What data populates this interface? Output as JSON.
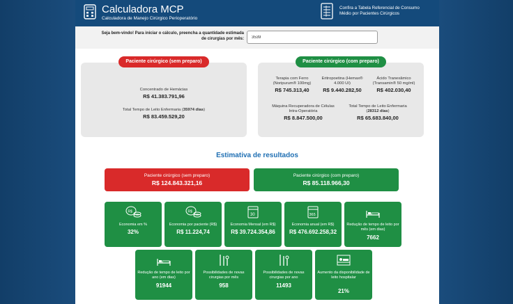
{
  "header": {
    "app_title": "Calculadora MCP",
    "app_subtitle": "Calculadora de Manejo Cirúrgico Perioperatório",
    "table_link": "Confira a Tabela Referencial de Consumo Médio por Pacientes Cirúrgicos"
  },
  "welcome": {
    "prompt": "Seja bem-vindo! Para iniciar o cálculo, preencha a quantidade estimada de cirurgias por mês:",
    "quantity_value": "3539"
  },
  "without_prep": {
    "title": "Paciente cirúrgico (sem preparo)",
    "items": [
      {
        "label": "Concentrado de Hemácias",
        "value": "R$ 41.383.791,96"
      },
      {
        "label_prefix": "Total Tempo de Leito Enfermaria (",
        "label_days": "35974 dias",
        "label_suffix": ")",
        "value": "R$ 83.459.529,20"
      }
    ]
  },
  "with_prep": {
    "title": "Paciente cirúrgico (com preparo)",
    "items": [
      {
        "label": "Terapia com Ferro (Noripurum® 100mg)",
        "value": "R$ 745.313,40"
      },
      {
        "label": "Eritropoetina (Hemax® 4.000 UI)",
        "value": "R$ 9.440.282,50"
      },
      {
        "label": "Ácido Tranexâmico (Transamin® 50 mg/ml)",
        "value": "R$ 402.030,40"
      },
      {
        "label": "Máquina Recuperadora de Células Intra-Operatória",
        "value": "R$ 8.847.500,00"
      },
      {
        "label_prefix": "Total Tempo de Leito Enfermaria (",
        "label_days": "28312 dias",
        "label_suffix": ")",
        "value": "R$ 65.683.840,00"
      }
    ]
  },
  "results": {
    "title": "Estimativa de resultados",
    "total_without": {
      "label": "Paciente cirúrgico (sem preparo)",
      "value": "R$ 124.843.321,16"
    },
    "total_with": {
      "label": "Paciente cirúrgico (com preparo)",
      "value": "R$ 85.118.966,30"
    },
    "cards": [
      {
        "icon": "coins-icon",
        "label": "Economia em %",
        "value": "32%"
      },
      {
        "icon": "coins-icon",
        "label": "Economia por paciente (R$)",
        "value": "R$ 11.224,74"
      },
      {
        "icon": "calendar-30-icon",
        "label": "Economia Mensal (em R$)",
        "value": "R$ 39.724.354,86"
      },
      {
        "icon": "calendar-365-icon",
        "label": "Economia anual (em R$)",
        "value": "R$ 476.692.258,32"
      },
      {
        "icon": "bed-icon",
        "label": "Redução de tempo de leito por mês (em dias)",
        "value": "7662"
      },
      {
        "icon": "bed-icon",
        "label": "Redução de tempo de leito por ano (em dias)",
        "value": "91944"
      },
      {
        "icon": "surgical-tools-icon",
        "label": "Possibilidades de novas cirurgias por mês",
        "value": "958"
      },
      {
        "icon": "surgical-tools-icon",
        "label": "Possibilidades de novas cirurgias por ano",
        "value": "11493"
      },
      {
        "icon": "patient-bed-icon",
        "label": "Aumento da disponibilidade de leito hospitalar",
        "value": "21%"
      }
    ]
  },
  "colors": {
    "red": "#d92a2a",
    "green": "#1f8f44",
    "header_blue": "#144a7b",
    "title_blue": "#1f6fb3"
  }
}
